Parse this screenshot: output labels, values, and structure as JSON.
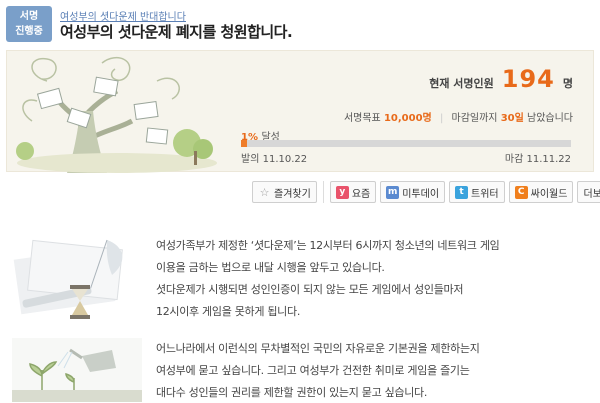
{
  "status_badge": {
    "line1": "서명",
    "line2": "진행중"
  },
  "petition": {
    "category": "여성부의 셧다운제 반대합니다",
    "title": "여성부의 셧다운제 폐지를 청원합니다."
  },
  "stats": {
    "signers_label": "현재 서명인원",
    "signers_count": "194",
    "signers_unit": "명",
    "goal_label": "서명목표",
    "goal_value": "10,000명",
    "deadline_label": "마감일까지",
    "deadline_value": "30일",
    "deadline_suffix": "남았습니다",
    "progress_pct_value": "1%",
    "progress_pct_label": "달성",
    "progress_fraction": 0.0194,
    "start_label": "발의",
    "start_date": "11.10.22",
    "end_label": "마감",
    "end_date": "11.11.22"
  },
  "actions": {
    "bookmark": "즐겨찾기",
    "yozm": "요즘",
    "me2day": "미투데이",
    "twitter": "트위터",
    "cyworld": "싸이월드",
    "more": "더보기"
  },
  "body": {
    "section1": [
      "여성가족부가 제정한 ‘셧다운제’는 12시부터 6시까지 청소년의 네트워크 게임",
      "이용을 금하는 법으로 내달 시행을 앞두고 있습니다.",
      "셧다운제가 시행되면 성인인증이 되지 않는 모든 게임에서 성인들마저",
      "12시이후 게임을 못하게 됩니다."
    ],
    "section2": [
      "어느나라에서 이런식의 무차별적인 국민의 자유로운 기본권을 제한하는지",
      "여성부에 묻고 싶습니다. 그리고 여성부가 건전한 취미로 게임을 즐기는",
      "대다수 성인들의 권리를 제한할 권한이 있는지 묻고 싶습니다."
    ]
  },
  "colors": {
    "accent": "#e86a1a",
    "badge": "#7a9fc9",
    "link": "#5a7fb5"
  }
}
